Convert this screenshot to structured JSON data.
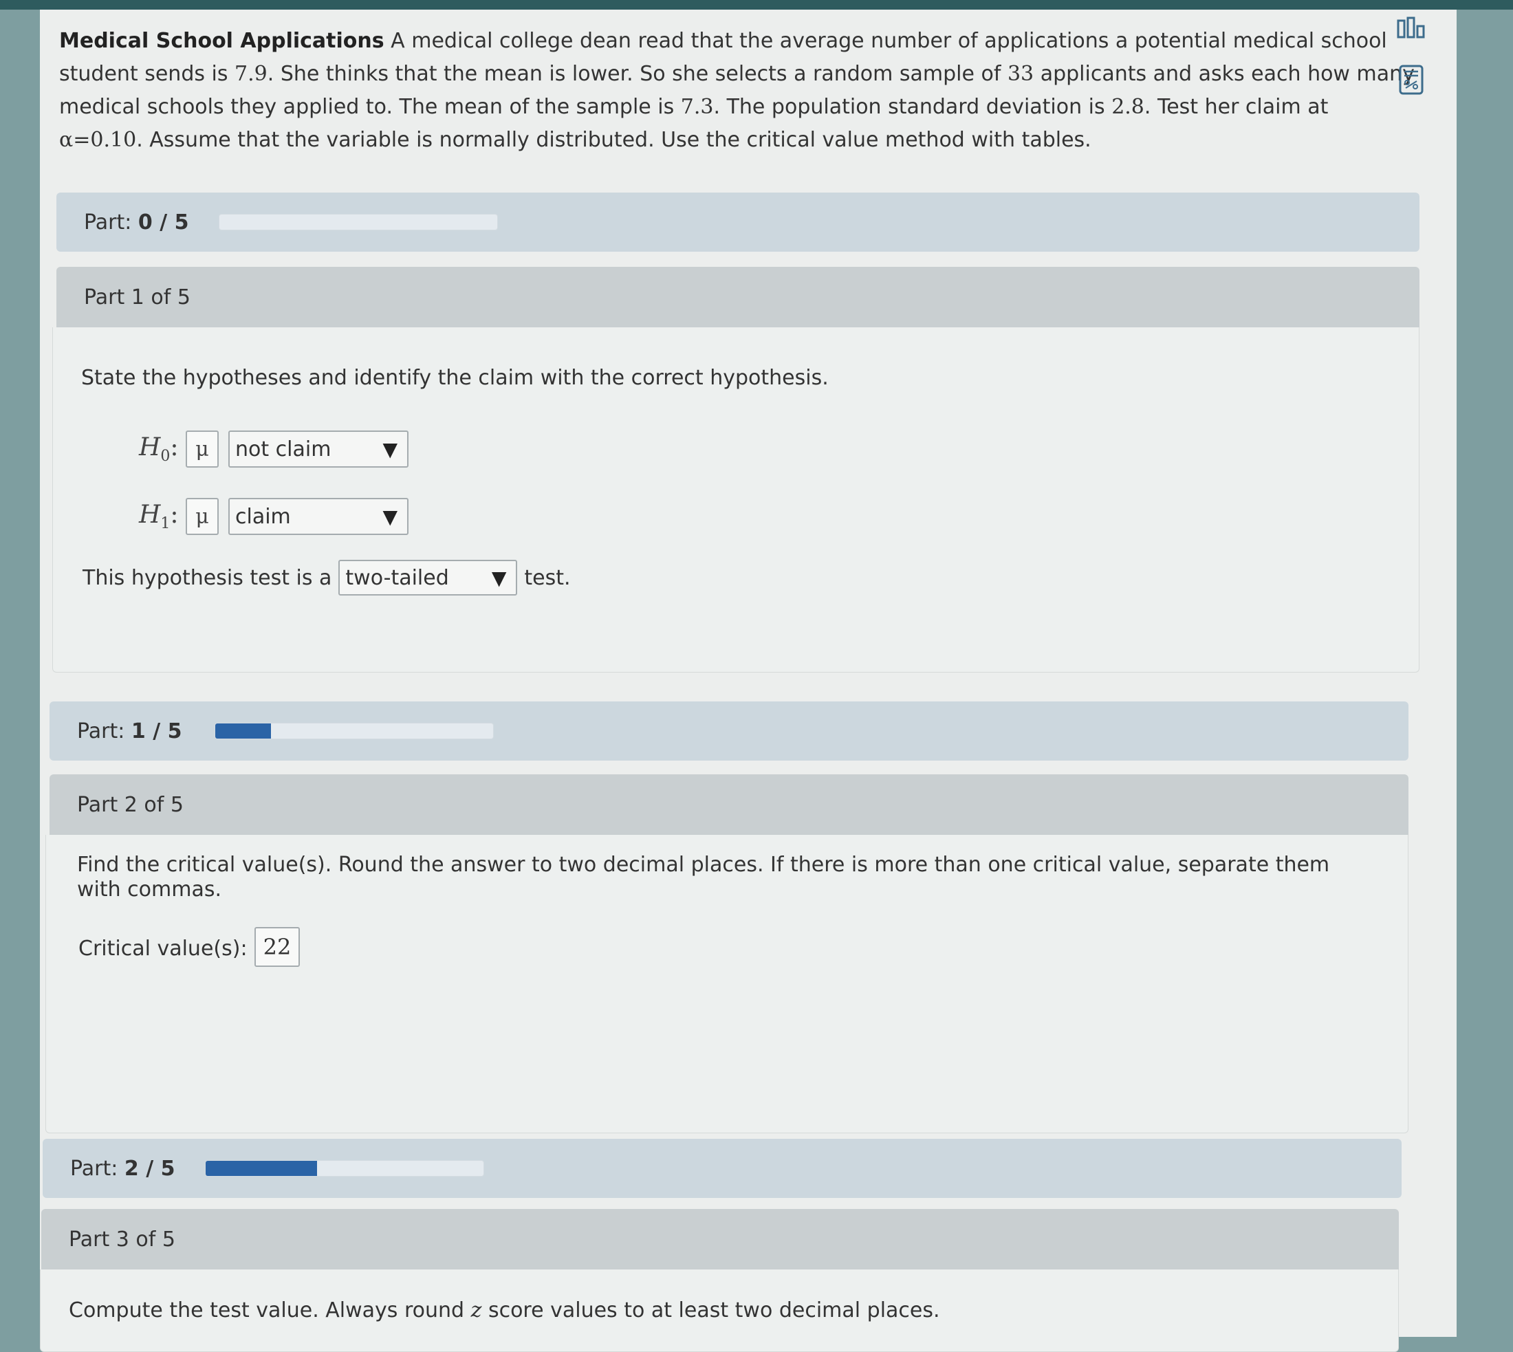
{
  "problem": {
    "title": "Medical School Applications",
    "text_1": "A medical college dean read that the average number of applications a potential medical school",
    "text_2a": "student sends is ",
    "mean_claimed": "7.9",
    "text_2b": ". She thinks that the mean is lower. So she selects a random sample of ",
    "sample_size": "33",
    "text_2c": " applicants and asks each how many",
    "text_3a": "medical schools they applied to. The mean of the sample is ",
    "sample_mean": "7.3",
    "text_3b": ". The population standard deviation is ",
    "pop_sd": "2.8",
    "text_3c": ". Test her claim at",
    "alpha": "α=0.10",
    "text_4": ". Assume that the variable is normally distributed. Use the critical value method with tables."
  },
  "tools": {
    "icon_1": "data-table-icon",
    "icon_2": "calculator-icon"
  },
  "progress_bars": [
    {
      "label": "Part: ",
      "value": "0 / 5",
      "fraction": 0.0
    },
    {
      "label": "Part: ",
      "value": "1 / 5",
      "fraction": 0.2
    },
    {
      "label": "Part: ",
      "value": "2 / 5",
      "fraction": 0.4
    }
  ],
  "part1": {
    "header": "Part 1 of 5",
    "instruction": "State the hypotheses and identify the claim with the correct hypothesis.",
    "h0_label": "H",
    "h0_sub": "0",
    "h1_label": "H",
    "h1_sub": "1",
    "colon": ":",
    "mu": "μ",
    "h0_select": "not claim",
    "h1_select": "claim",
    "test_text_a": "This hypothesis test is a",
    "test_select": "two-tailed",
    "test_text_b": "test."
  },
  "part2": {
    "header": "Part 2 of 5",
    "instruction_1": "Find the critical value(s). Round the answer to two decimal places. If there is more than one critical value, separate them",
    "instruction_2": "with commas.",
    "critical_label": "Critical value(s):",
    "critical_value": "22"
  },
  "part3": {
    "header": "Part 3 of 5",
    "instruction_a": "Compute the test value. Always round ",
    "instruction_z": "z",
    "instruction_b": " score values to at least two decimal places."
  },
  "glyphs": {
    "arrow": "▼"
  }
}
